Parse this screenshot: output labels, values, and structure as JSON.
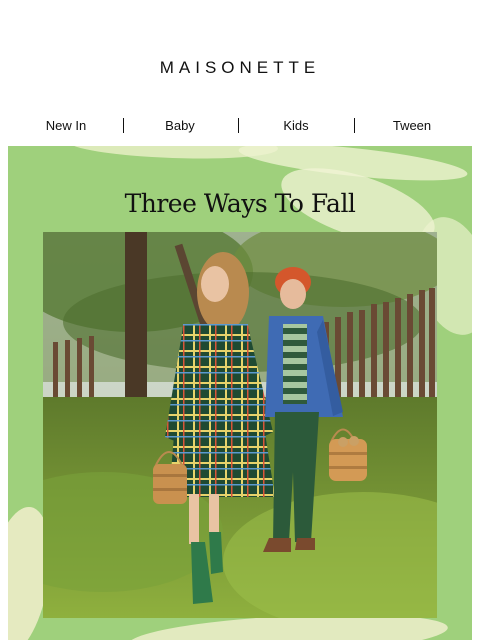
{
  "brand": {
    "logo_text": "MAISONETTE"
  },
  "nav": {
    "items": [
      {
        "label": "New In"
      },
      {
        "label": "Baby"
      },
      {
        "label": "Kids"
      },
      {
        "label": "Tween"
      }
    ]
  },
  "hero": {
    "title": "Three Ways To Fall",
    "background_color": "#9fd07c",
    "photo_icon": "two-children-autumn-photo"
  }
}
